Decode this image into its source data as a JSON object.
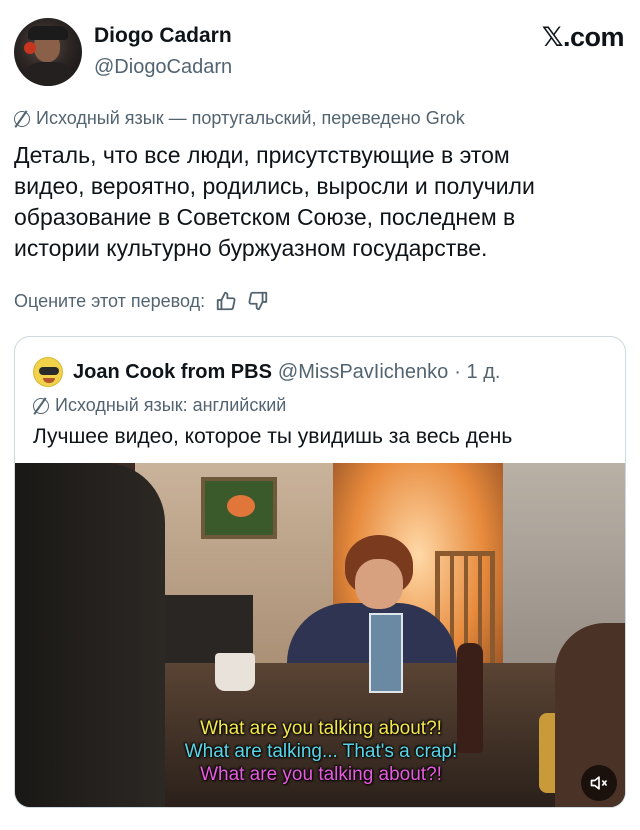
{
  "post": {
    "author_name": "Diogo Cadarn",
    "author_handle": "@DiogoCadarn",
    "brand": "𝕏.com",
    "translation_note": "Исходный язык — португальский, переведено Grok",
    "text_lines": [
      "Деталь, что все люди, присутствующие в этом",
      "видео, вероятно, родились, выросли и получили",
      "образование в Советском Союзе, последнем в",
      "истории культурно буржуазном государстве."
    ],
    "rate_label": "Оцените этот перевод:"
  },
  "quote": {
    "author_name": "Joan Cook from PBS",
    "author_handle": "@MissPavIichenko",
    "time": "· 1 д.",
    "language_note": "Исходный язык: английский",
    "text": "Лучшее видео, которое ты увидишь за весь день",
    "subtitles": [
      "What are you talking about?!",
      "What are talking... That's a crap!",
      "What are you talking about?!"
    ]
  },
  "colors": {
    "text_primary": "#0f1419",
    "text_secondary": "#536471",
    "border": "#cfd9de"
  },
  "icons": [
    "translate-icon",
    "thumbs-up-icon",
    "thumbs-down-icon",
    "mute-icon"
  ]
}
